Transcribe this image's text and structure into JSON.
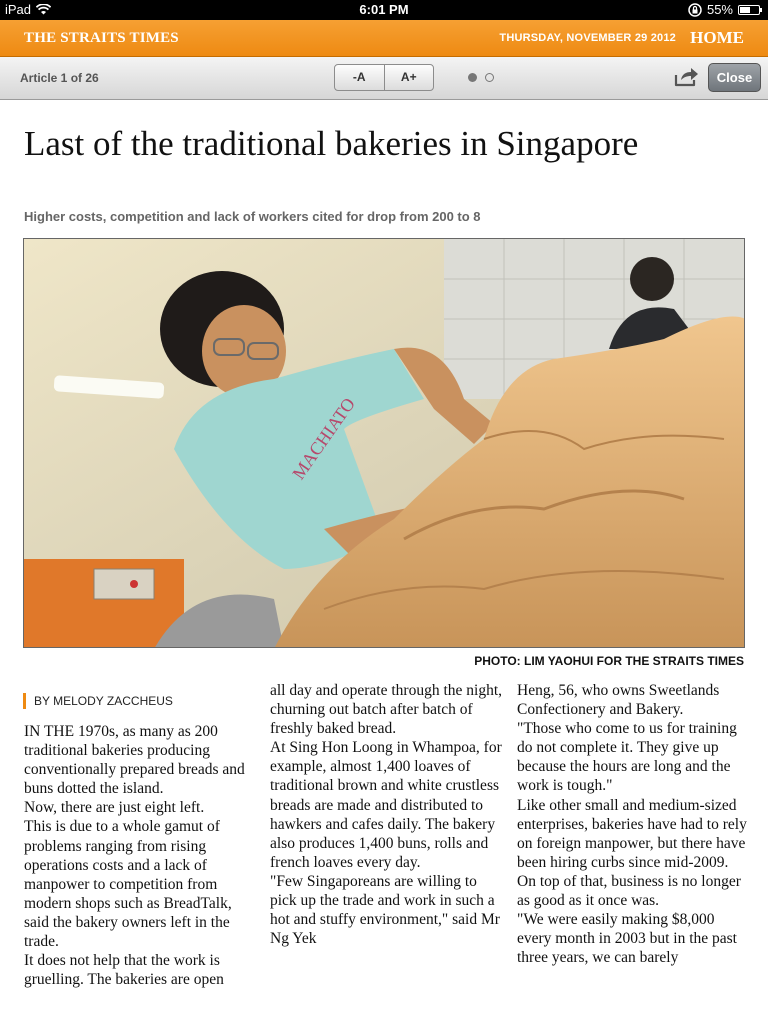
{
  "status_bar": {
    "device": "iPad",
    "time": "6:01 PM",
    "battery": "55%",
    "battery_level": 0.55
  },
  "brand": {
    "logo": "THE STRAITS TIMES",
    "date": "THURSDAY, NOVEMBER 29 2012",
    "home": "HOME"
  },
  "toolbar": {
    "article_count": "Article 1 of 26",
    "font_smaller": "-A",
    "font_larger": "A+",
    "close": "Close",
    "page_dots": 2,
    "active_dot": 1
  },
  "article": {
    "headline": "Last of the traditional bakeries in Singapore",
    "subhead": "Higher costs, competition and lack of workers cited for drop from 200 to 8",
    "photo_credit": "PHOTO: LIM YAOHUI FOR THE STRAITS TIMES",
    "byline": "BY MELODY ZACCHEUS",
    "shirt_print": "MACHIATO",
    "columns": [
      "IN THE 1970s, as many as 200 traditional bakeries producing conventionally prepared breads and buns dotted the island.\n Now, there are just eight left.\n This is due to a whole gamut of problems ranging from rising operations costs and a lack of manpower to competition from modern shops such as BreadTalk, said the bakery owners left in the trade.\n It does not help that the work is gruelling. The bakeries are open",
      "all day and operate through the night, churning out batch after batch of freshly baked bread.\n At Sing Hon Loong in Whampoa, for example, almost 1,400 loaves of traditional brown and white crustless breads are made and distributed to hawkers and cafes daily. The bakery also produces 1,400 buns, rolls and french loaves every day.\n\"Few Singaporeans are willing to pick up the trade and work in such a hot and stuffy environment,\" said Mr Ng Yek",
      "Heng, 56, who owns Sweetlands Confectionery and Bakery.\n\"Those who come to us for training do not complete it. They give up because the hours are long and the work is tough.\"\n Like other small and medium-sized enterprises, bakeries have had to rely on foreign manpower, but there have been hiring curbs since mid-2009.\n On top of that, business is no longer as good as it once was.\n\"We were easily making $8,000 every month in 2003 but in the past three years, we can barely"
    ]
  }
}
